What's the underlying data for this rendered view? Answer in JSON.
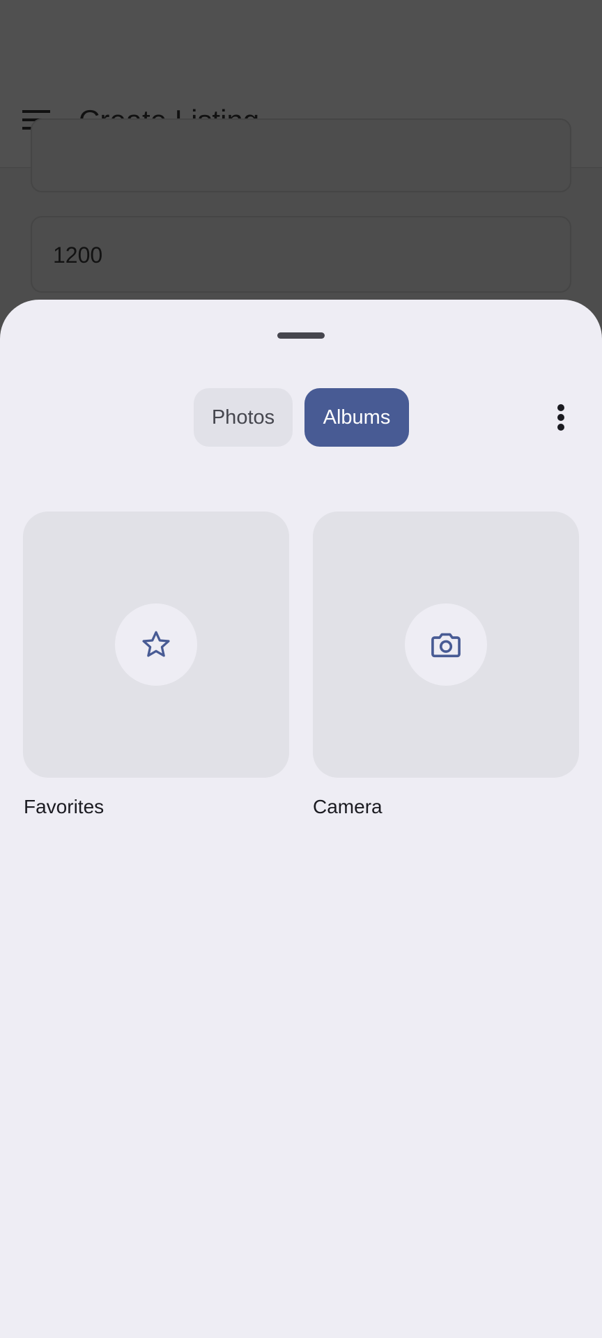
{
  "app_bar": {
    "title": "Create Listing",
    "menu_icon": "hamburger-menu-icon"
  },
  "form": {
    "price_value": "1200"
  },
  "sheet": {
    "tabs": [
      {
        "label": "Photos",
        "selected": false
      },
      {
        "label": "Albums",
        "selected": true
      }
    ],
    "overflow_icon": "more-vert-icon",
    "albums": [
      {
        "label": "Favorites",
        "icon": "star-outline-icon"
      },
      {
        "label": "Camera",
        "icon": "camera-icon"
      }
    ]
  },
  "colors": {
    "accent": "#485b94",
    "sheet_background": "#eeedf4",
    "card_background": "#e1e1e7",
    "scrim": "#4d4d4d"
  }
}
